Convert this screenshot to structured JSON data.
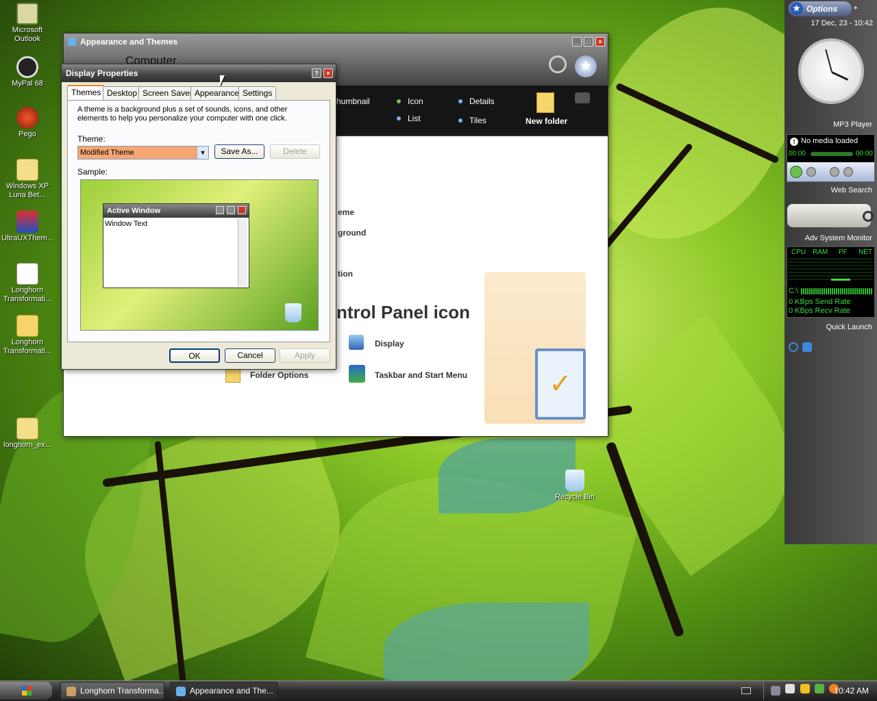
{
  "desktop": {
    "icons": [
      {
        "label": "Microsoft Outlook"
      },
      {
        "label": "MyPal 68"
      },
      {
        "label": "Pego"
      },
      {
        "label": "Windows XP Luna Bet..."
      },
      {
        "label": "UltraUXThem..."
      },
      {
        "label": "Longhorn Transformati..."
      },
      {
        "label": "Longhorn Transformati..."
      },
      {
        "label": "longhorn_ex..."
      }
    ],
    "recycle_bin": "Recycle Bin"
  },
  "explorer": {
    "title": "Appearance and Themes",
    "address": "Computer",
    "views": {
      "thumbnail": "humbnail",
      "icon": "Icon",
      "details": "Details",
      "list": "List",
      "tiles": "Tiles"
    },
    "new_folder": "New folder",
    "tasks": {
      "t1": "eme",
      "t2": "ground",
      "t3": "tion"
    },
    "heading": "ntrol Panel icon",
    "links": {
      "display": "Display",
      "taskbar": "Taskbar and Start Menu",
      "folder_options": "Folder Options"
    }
  },
  "dialog": {
    "title": "Display Properties",
    "tabs": [
      "Themes",
      "Desktop",
      "Screen Saver",
      "Appearance",
      "Settings"
    ],
    "description": "A theme is a background plus a set of sounds, icons, and other elements to help you personalize your computer with one click.",
    "theme_label": "Theme:",
    "theme_value": "Modified Theme",
    "save_as": "Save As...",
    "delete": "Delete",
    "sample_label": "Sample:",
    "sample_window_title": "Active Window",
    "sample_window_text": "Window Text",
    "ok": "OK",
    "cancel": "Cancel",
    "apply": "Apply"
  },
  "sidebar": {
    "options": "Options",
    "datetime": "17 Dec, 23 - 10:42",
    "mp3_title": "MP3 Player",
    "mp3_status": "No media loaded",
    "mp3_time_left": "00:00",
    "mp3_time_right": "00:00",
    "web_search_title": "Web Search",
    "sysmon_title": "Adv System Monitor",
    "sysmon_cols": [
      "CPU",
      "RAM",
      "PF",
      "NET"
    ],
    "drive": "C:\\",
    "send_rate": "0 KBps Send Rate",
    "recv_rate": "0 KBps Recv Rate",
    "quick_launch_title": "Quick Launch"
  },
  "taskbar": {
    "tasks": [
      {
        "label": "Longhorn Transforma..."
      },
      {
        "label": "Appearance and The..."
      }
    ],
    "clock": "10:42 AM"
  },
  "colors": {
    "accent": "#e68b2c",
    "sysmon_text": "#3ddc3d",
    "theme_dropdown_bg": "#f5a673"
  }
}
